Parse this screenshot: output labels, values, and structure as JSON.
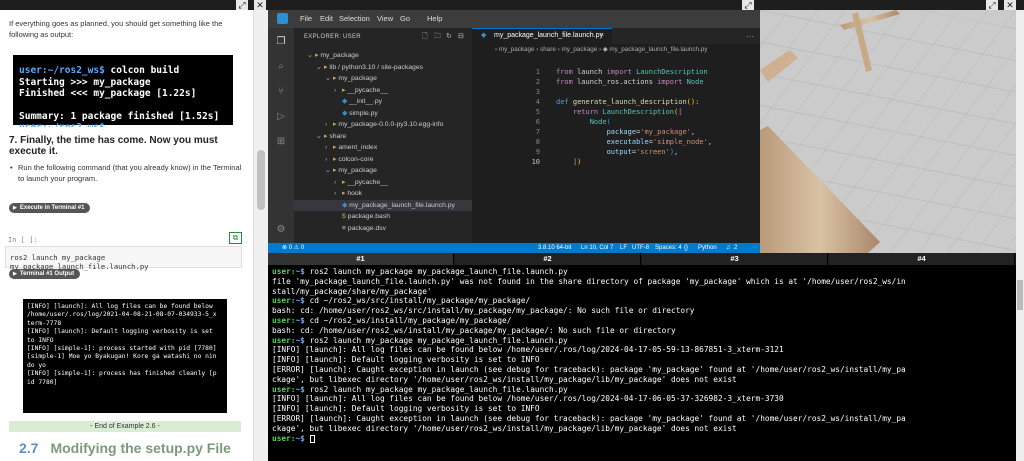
{
  "left": {
    "intro": "If everything goes as planned, you should get something like the following as output:",
    "build_terminal": {
      "prompt_user": "user:",
      "prompt_path": "~/ros2_ws$",
      "command": "colcon build",
      "lines": [
        "Starting >>> my_package",
        "Finished <<< my_package [1.22s]",
        "",
        "Summary: 1 package finished [1.52s]"
      ],
      "last_prompt": "user:~/ros2_ws$"
    },
    "heading": "7. Finally, the time has come. Now you must execute it.",
    "bullet": "Run the following command (that you already know) in the Terminal to launch your program.",
    "execute_btn": "Execute in Terminal #1",
    "in_prompt": "In [ ]:",
    "cell_code": "ros2 launch my_package my_package_launch_file.launch.py",
    "output_btn": "Terminal #1 Output",
    "output_lines": [
      "[INFO] [launch]: All log files can be found below",
      "/home/user/.ros/log/2021-04-08-21-08-07-034933-5_x",
      "term-7778",
      "[INFO] [launch]: Default logging verbosity is set",
      "to INFO",
      "[INFO] [simple-1]: process started with pid [7780]",
      "[simple-1] Moe yo Byakugan! Kore ga watashi no nin",
      "do yo",
      "[INFO] [simple-1]: process has finished cleanly [p",
      "id 7780]"
    ],
    "end_example": "- End of Example 2.6 -",
    "section_num": "2.7",
    "section_title": "Modifying the setup.py File"
  },
  "vscode": {
    "menu": [
      "File",
      "Edit",
      "Selection",
      "View",
      "Go",
      "Help"
    ],
    "explorer_title": "EXPLORER: USER",
    "tree": [
      {
        "label": "my_package",
        "kind": "folder",
        "chev": "⌄",
        "indent": 1
      },
      {
        "label": "lib / python3.10 / site-packages",
        "kind": "folder",
        "chev": "⌄",
        "indent": 2
      },
      {
        "label": "my_package",
        "kind": "folder",
        "chev": "⌄",
        "indent": 3
      },
      {
        "label": "__pycache__",
        "kind": "folder",
        "chev": "›",
        "indent": 4
      },
      {
        "label": "__init__.py",
        "kind": "py",
        "chev": "",
        "indent": 4
      },
      {
        "label": "simple.py",
        "kind": "py",
        "chev": "",
        "indent": 4
      },
      {
        "label": "my_package-0.0.0-py3.10.egg-info",
        "kind": "folder",
        "chev": "›",
        "indent": 3
      },
      {
        "label": "share",
        "kind": "folder",
        "chev": "⌄",
        "indent": 2
      },
      {
        "label": "ament_index",
        "kind": "folder",
        "chev": "›",
        "indent": 3
      },
      {
        "label": "colcon-core",
        "kind": "folder",
        "chev": "›",
        "indent": 3
      },
      {
        "label": "my_package",
        "kind": "folder",
        "chev": "⌄",
        "indent": 3
      },
      {
        "label": "__pycache__",
        "kind": "folder",
        "chev": "›",
        "indent": 4
      },
      {
        "label": "hook",
        "kind": "folder",
        "chev": "›",
        "indent": 4
      },
      {
        "label": "my_package_launch_file.launch.py",
        "kind": "py",
        "chev": "",
        "indent": 4
      },
      {
        "label": "package.bash",
        "kind": "sh",
        "chev": "",
        "indent": 4
      },
      {
        "label": "package.dsv",
        "kind": "ds",
        "chev": "",
        "indent": 4
      }
    ],
    "tab_label": "my_package_launch_file.launch.py",
    "breadcrumbs": "› my_package › share › my_package › ◆ my_package_launch_file.launch.py",
    "code_line_numbers": [
      "1",
      "2",
      "3",
      "4",
      "5",
      "6",
      "7",
      "8",
      "9",
      "10"
    ],
    "statusbar": {
      "problems": "⊗ 0 ⚠ 0",
      "python_ver": "3.8.10 64-bit",
      "position": "Ln 10, Col 7",
      "eol": "LF",
      "encoding": "UTF-8",
      "spaces": "Spaces: 4",
      "language": "Python",
      "notifications": "2"
    }
  },
  "terminal": {
    "tabs": [
      "#1",
      "#2",
      "#3",
      "#4"
    ],
    "lines": [
      {
        "prompt": true,
        "path": "~$",
        "text": " ros2 launch my_package my_package_launch_file.launch.py"
      },
      {
        "prompt": false,
        "text": "file 'my_package_launch_file.launch.py' was not found in the share directory of package 'my_package' which is at '/home/user/ros2_ws/in"
      },
      {
        "prompt": false,
        "text": "stall/my_package/share/my_package'"
      },
      {
        "prompt": true,
        "path": "~$",
        "text": " cd ~/ros2_ws/src/install/my_package/my_package/"
      },
      {
        "prompt": false,
        "text": "bash: cd: /home/user/ros2_ws/src/install/my_package/my_package/: No such file or directory"
      },
      {
        "prompt": true,
        "path": "~$",
        "text": " cd ~/ros2_ws/install/my_package/my_package/"
      },
      {
        "prompt": false,
        "text": "bash: cd: /home/user/ros2_ws/install/my_package/my_package/: No such file or directory"
      },
      {
        "prompt": true,
        "path": "~$",
        "text": " ros2 launch my_package my_package_launch_file.launch.py"
      },
      {
        "prompt": false,
        "text": "[INFO] [launch]: All log files can be found below /home/user/.ros/log/2024-04-17-05-59-13-867851-3_xterm-3121"
      },
      {
        "prompt": false,
        "text": "[INFO] [launch]: Default logging verbosity is set to INFO"
      },
      {
        "prompt": false,
        "text": "[ERROR] [launch]: Caught exception in launch (see debug for traceback): package 'my_package' found at '/home/user/ros2_ws/install/my_pa"
      },
      {
        "prompt": false,
        "text": "ckage', but libexec directory '/home/user/ros2_ws/install/my_package/lib/my_package' does not exist"
      },
      {
        "prompt": true,
        "path": "~$",
        "text": " ros2 launch my_package my_package_launch_file.launch.py"
      },
      {
        "prompt": false,
        "text": "[INFO] [launch]: All log files can be found below /home/user/.ros/log/2024-04-17-06-05-37-326982-3_xterm-3730"
      },
      {
        "prompt": false,
        "text": "[INFO] [launch]: Default logging verbosity is set to INFO"
      },
      {
        "prompt": false,
        "text": "[ERROR] [launch]: Caught exception in launch (see debug for traceback): package 'my_package' found at '/home/user/ros2_ws/install/my_pa"
      },
      {
        "prompt": false,
        "text": "ckage', but libexec directory '/home/user/ros2_ws/install/my_package/lib/my_package' does not exist"
      }
    ],
    "final_prompt_user": "user:",
    "final_prompt_path": "~$",
    "user": "user:"
  },
  "colors": {
    "vscode_status": "#007acc",
    "prompt_green": "#58d058",
    "section_num": "#5b8fc7",
    "end_example_bg": "#d9ecd4"
  }
}
